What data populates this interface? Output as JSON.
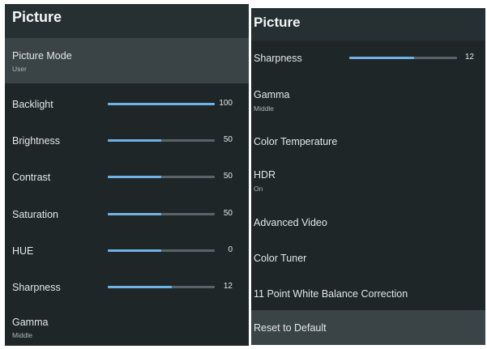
{
  "left": {
    "title": "Picture",
    "picture_mode": {
      "label": "Picture Mode",
      "value": "User"
    },
    "sliders": [
      {
        "label": "Backlight",
        "value": 100,
        "max": 100
      },
      {
        "label": "Brightness",
        "value": 50,
        "max": 100
      },
      {
        "label": "Contrast",
        "value": 50,
        "max": 100
      },
      {
        "label": "Saturation",
        "value": 50,
        "max": 100
      },
      {
        "label": "HUE",
        "value": 0,
        "max": 100,
        "display_fill": 0.5
      },
      {
        "label": "Sharpness",
        "value": 12,
        "max": 20
      }
    ],
    "gamma": {
      "label": "Gamma",
      "value": "Middle"
    }
  },
  "right": {
    "title": "Picture",
    "sharpness": {
      "label": "Sharpness",
      "value": 12,
      "max": 20
    },
    "gamma": {
      "label": "Gamma",
      "value": "Middle"
    },
    "color_temperature": {
      "label": "Color Temperature"
    },
    "hdr": {
      "label": "HDR",
      "value": "On"
    },
    "advanced_video": {
      "label": "Advanced Video"
    },
    "color_tuner": {
      "label": "Color Tuner"
    },
    "white_balance": {
      "label": "11 Point White Balance Correction"
    },
    "reset": {
      "label": "Reset to Default"
    }
  },
  "colors": {
    "panel_bg": "#1f2628",
    "highlight_bg": "#3a4447",
    "slider_fill": "#6fb3e6",
    "slider_track": "#5a6366",
    "text": "#e3e7e7"
  }
}
